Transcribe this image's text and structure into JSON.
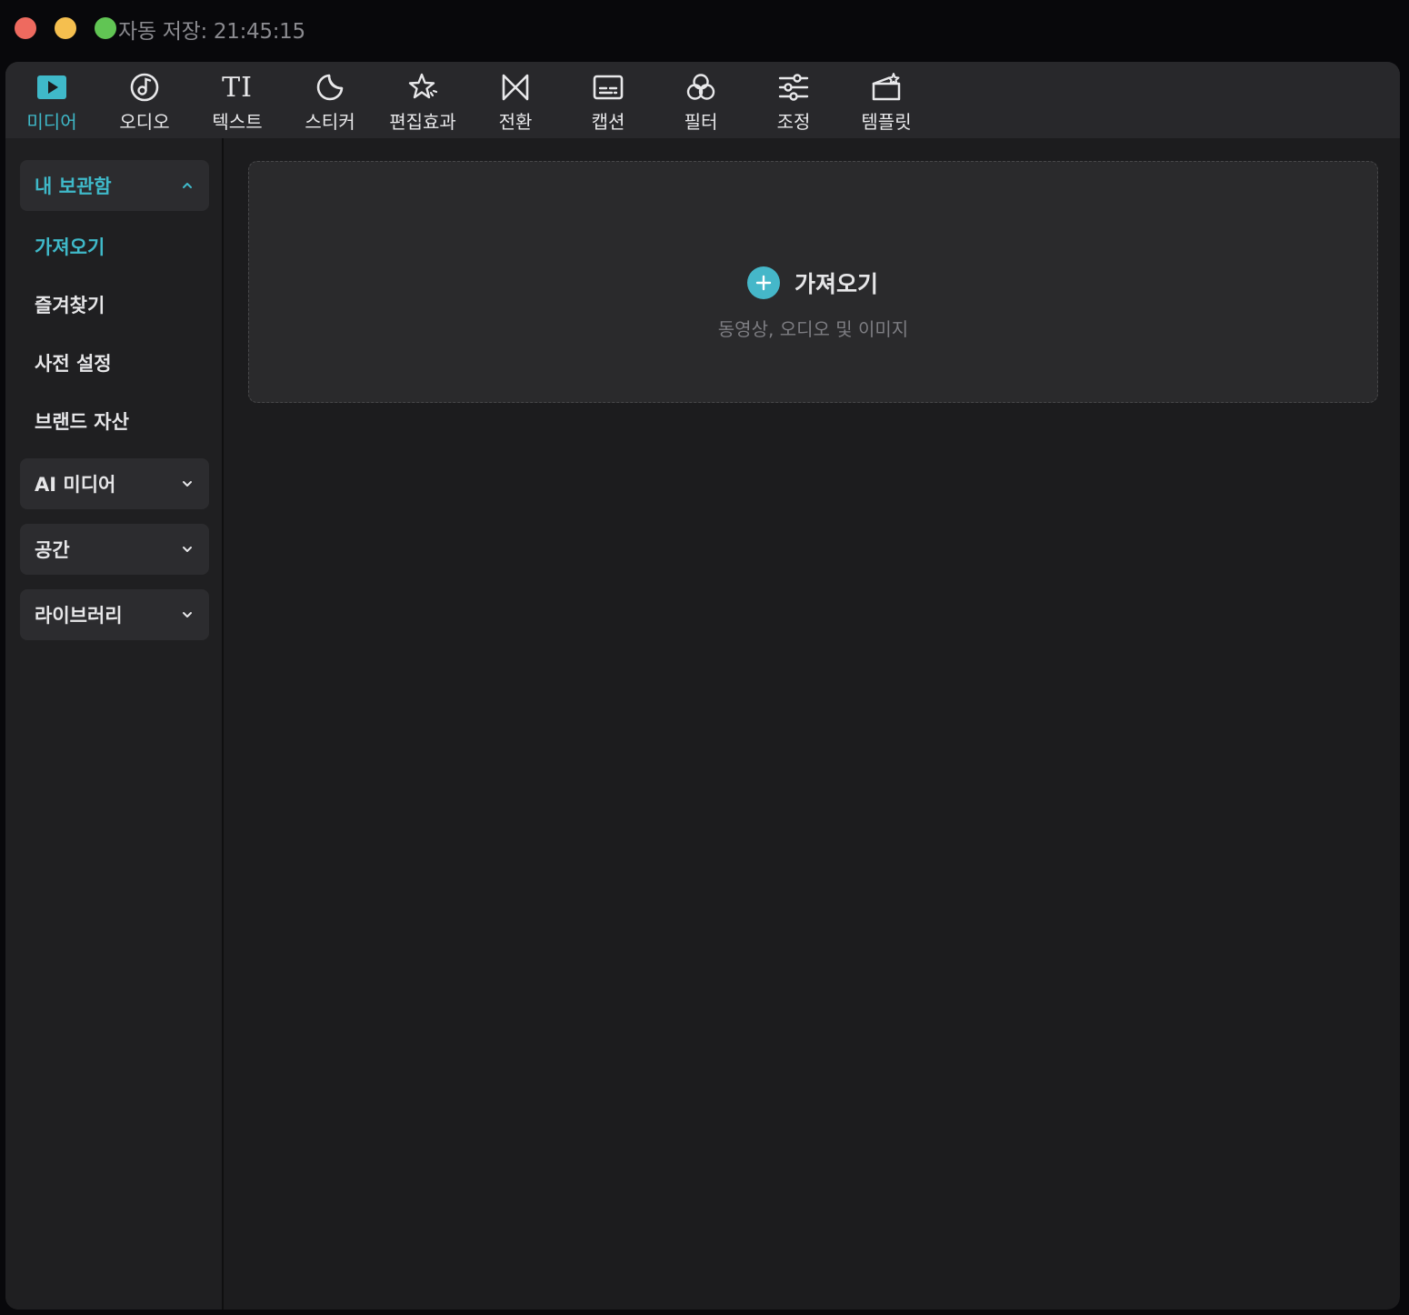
{
  "titlebar": {
    "autosave_text": "자동 저장: 21:45:15"
  },
  "toolbar": {
    "tabs": [
      {
        "label": "미디어",
        "icon": "media-play-icon",
        "active": true
      },
      {
        "label": "오디오",
        "icon": "music-note-icon",
        "active": false
      },
      {
        "label": "텍스트",
        "icon": "text-ti-icon",
        "active": false
      },
      {
        "label": "스티커",
        "icon": "sticker-icon",
        "active": false
      },
      {
        "label": "편집효과",
        "icon": "sparkle-star-icon",
        "active": false
      },
      {
        "label": "전환",
        "icon": "transition-bowtie-icon",
        "active": false
      },
      {
        "label": "캡션",
        "icon": "caption-icon",
        "active": false
      },
      {
        "label": "필터",
        "icon": "filter-rings-icon",
        "active": false
      },
      {
        "label": "조정",
        "icon": "sliders-icon",
        "active": false
      },
      {
        "label": "템플릿",
        "icon": "template-icon",
        "active": false
      }
    ],
    "ti_glyph": "TI"
  },
  "sidebar": {
    "my_library": {
      "label": "내 보관함",
      "expanded": true
    },
    "items": [
      {
        "label": "가져오기",
        "active": true
      },
      {
        "label": "즐겨찾기",
        "active": false
      },
      {
        "label": "사전 설정",
        "active": false
      },
      {
        "label": "브랜드 자산",
        "active": false
      }
    ],
    "groups": [
      {
        "label": "AI 미디어",
        "expanded": false
      },
      {
        "label": "공간",
        "expanded": false
      },
      {
        "label": "라이브러리",
        "expanded": false
      }
    ]
  },
  "import_zone": {
    "title": "가져오기",
    "subtitle": "동영상, 오디오 및 이미지"
  },
  "colors": {
    "accent": "#3fb9c9",
    "plus_bg": "#45b7c9",
    "window_bg": "#1c1c1e",
    "toolbar_bg": "#28282b"
  }
}
